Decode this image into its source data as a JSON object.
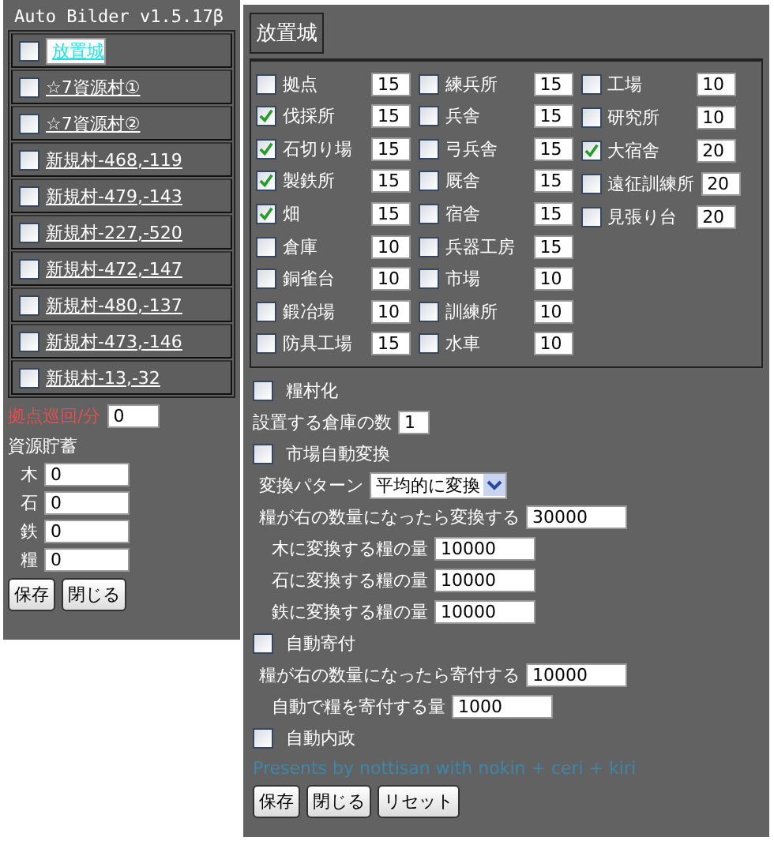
{
  "left_panel": {
    "title": "Auto Bilder v1.5.17β",
    "villages": [
      {
        "name": "放置城",
        "checked": false,
        "selected": true
      },
      {
        "name": "☆7資源村①",
        "checked": false,
        "selected": false
      },
      {
        "name": "☆7資源村②",
        "checked": false,
        "selected": false
      },
      {
        "name": "新規村-468,-119",
        "checked": false,
        "selected": false
      },
      {
        "name": "新規村-479,-143",
        "checked": false,
        "selected": false
      },
      {
        "name": "新規村-227,-520",
        "checked": false,
        "selected": false
      },
      {
        "name": "新規村-472,-147",
        "checked": false,
        "selected": false
      },
      {
        "name": "新規村-480,-137",
        "checked": false,
        "selected": false
      },
      {
        "name": "新規村-473,-146",
        "checked": false,
        "selected": false
      },
      {
        "name": "新規村-13,-32",
        "checked": false,
        "selected": false
      }
    ],
    "patrol": {
      "label": "拠点巡回/分",
      "value": "0"
    },
    "storage_title": "資源貯蓄",
    "storage": [
      {
        "label": "木",
        "value": "0"
      },
      {
        "label": "石",
        "value": "0"
      },
      {
        "label": "鉄",
        "value": "0"
      },
      {
        "label": "糧",
        "value": "0"
      }
    ],
    "buttons": [
      "保存",
      "閉じる"
    ]
  },
  "right_panel": {
    "tab": "放置城",
    "building_columns": [
      [
        {
          "name": "拠点",
          "checked": false,
          "value": "15"
        },
        {
          "name": "伐採所",
          "checked": true,
          "value": "15"
        },
        {
          "name": "石切り場",
          "checked": true,
          "value": "15"
        },
        {
          "name": "製鉄所",
          "checked": true,
          "value": "15"
        },
        {
          "name": "畑",
          "checked": true,
          "value": "15"
        },
        {
          "name": "倉庫",
          "checked": false,
          "value": "10"
        },
        {
          "name": "銅雀台",
          "checked": false,
          "value": "10"
        },
        {
          "name": "鍛冶場",
          "checked": false,
          "value": "10"
        },
        {
          "name": "防具工場",
          "checked": false,
          "value": "15"
        }
      ],
      [
        {
          "name": "練兵所",
          "checked": false,
          "value": "15"
        },
        {
          "name": "兵舎",
          "checked": false,
          "value": "15"
        },
        {
          "name": "弓兵舎",
          "checked": false,
          "value": "15"
        },
        {
          "name": "厩舎",
          "checked": false,
          "value": "15"
        },
        {
          "name": "宿舎",
          "checked": false,
          "value": "15"
        },
        {
          "name": "兵器工房",
          "checked": false,
          "value": "15"
        },
        {
          "name": "市場",
          "checked": false,
          "value": "10"
        },
        {
          "name": "訓練所",
          "checked": false,
          "value": "10"
        },
        {
          "name": "水車",
          "checked": false,
          "value": "10"
        }
      ],
      [
        {
          "name": "工場",
          "checked": false,
          "value": "10"
        },
        {
          "name": "研究所",
          "checked": false,
          "value": "10"
        },
        {
          "name": "大宿舎",
          "checked": true,
          "value": "20"
        },
        {
          "name": "遠征訓練所",
          "checked": false,
          "value": "20"
        },
        {
          "name": "見張り台",
          "checked": false,
          "value": "20"
        }
      ]
    ],
    "settings": [
      {
        "kind": "check",
        "label": "糧村化",
        "checked": false
      },
      {
        "kind": "field",
        "label": "設置する倉庫の数",
        "value": "1"
      },
      {
        "kind": "check",
        "label": "市場自動変換",
        "checked": false,
        "children": [
          {
            "kind": "select",
            "label": "変換パターン",
            "value": "平均的に変換"
          },
          {
            "kind": "field",
            "label": "糧が右の数量になったら変換する",
            "value": "30000",
            "children": [
              {
                "kind": "field",
                "label": "木に変換する糧の量",
                "value": "10000"
              },
              {
                "kind": "field",
                "label": "石に変換する糧の量",
                "value": "10000"
              },
              {
                "kind": "field",
                "label": "鉄に変換する糧の量",
                "value": "10000"
              }
            ]
          }
        ]
      },
      {
        "kind": "check",
        "label": "自動寄付",
        "checked": false,
        "children": [
          {
            "kind": "field",
            "label": "糧が右の数量になったら寄付する",
            "value": "10000",
            "children": [
              {
                "kind": "field",
                "label": "自動で糧を寄付する量",
                "value": "1000"
              }
            ]
          }
        ]
      },
      {
        "kind": "check",
        "label": "自動内政",
        "checked": false
      }
    ],
    "credit": "Presents by nottisan with nokin + ceri + kiri",
    "buttons": [
      "保存",
      "閉じる",
      "リセット"
    ]
  }
}
